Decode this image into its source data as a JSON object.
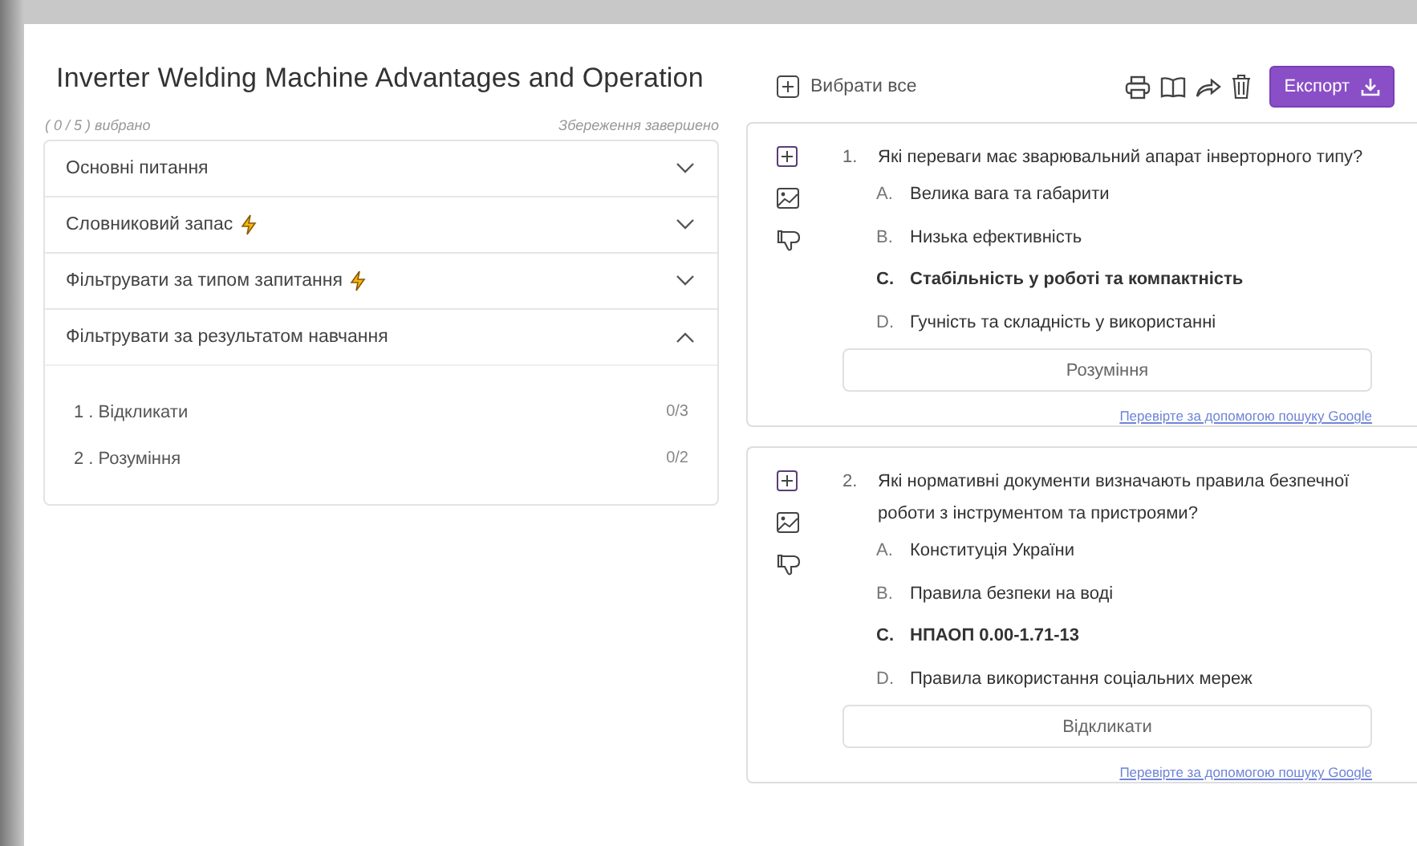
{
  "title": "Inverter Welding Machine Advantages and Operation",
  "selected_count": "( 0 / 5 ) вибрано",
  "save_status": "Збереження завершено",
  "sections": [
    {
      "label": "Основні питання",
      "bolt": false,
      "expanded": false
    },
    {
      "label": "Словниковий запас",
      "bolt": true,
      "expanded": false
    },
    {
      "label": "Фільтрувати за типом запитання",
      "bolt": true,
      "expanded": false
    },
    {
      "label": "Фільтрувати за результатом навчання",
      "bolt": false,
      "expanded": true,
      "items": [
        {
          "label": "1 . Відкликати",
          "count": "0/3"
        },
        {
          "label": "2 . Розуміння",
          "count": "0/2"
        }
      ]
    }
  ],
  "select_all": "Вибрати все",
  "export_button": "Експорт",
  "questions": [
    {
      "number": "1.",
      "text": "Які переваги має зварювальний апарат інверторного типу?",
      "options": [
        {
          "letter": "A.",
          "text": "Велика вага та габарити",
          "correct": false
        },
        {
          "letter": "B.",
          "text": "Низька ефективність",
          "correct": false
        },
        {
          "letter": "C.",
          "text": "Стабільність у роботі та компактність",
          "correct": true
        },
        {
          "letter": "D.",
          "text": "Гучність та складність у використанні",
          "correct": false
        }
      ],
      "tag": "Розуміння",
      "link": "Перевірте за допомогою пошуку Google"
    },
    {
      "number": "2.",
      "text": "Які нормативні документи визначають правила безпечної роботи з інструментом та пристроями?",
      "options": [
        {
          "letter": "A.",
          "text": "Конституція України",
          "correct": false
        },
        {
          "letter": "B.",
          "text": "Правила безпеки на воді",
          "correct": false
        },
        {
          "letter": "C.",
          "text": "НПАОП 0.00-1.71-13",
          "correct": true
        },
        {
          "letter": "D.",
          "text": "Правила використання соціальних мереж",
          "correct": false
        }
      ],
      "tag": "Відкликати",
      "link": "Перевірте за допомогою пошуку Google"
    }
  ]
}
